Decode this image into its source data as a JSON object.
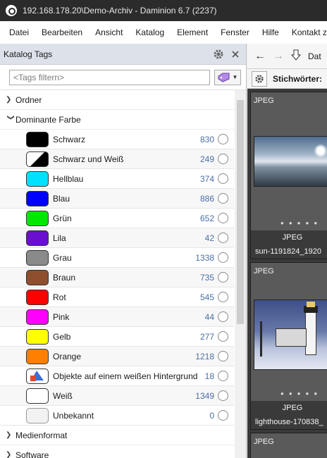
{
  "window": {
    "title": "192.168.178.20\\Demo-Archiv - Daminion 6.7 (2237)"
  },
  "menu": [
    "Datei",
    "Bearbeiten",
    "Ansicht",
    "Katalog",
    "Element",
    "Fenster",
    "Hilfe",
    "Kontakt z"
  ],
  "panel": {
    "title": "Katalog Tags",
    "filter_placeholder": "<Tags filtern>"
  },
  "groups": {
    "ordner": "Ordner",
    "dominante": "Dominante Farbe",
    "medienformat": "Medienformat",
    "software": "Software"
  },
  "colors": [
    {
      "label": "Schwarz",
      "count": "830",
      "color": "#000000"
    },
    {
      "label": "Schwarz und Weiß",
      "count": "249",
      "color": "split"
    },
    {
      "label": "Hellblau",
      "count": "374",
      "color": "#00e1ff"
    },
    {
      "label": "Blau",
      "count": "886",
      "color": "#0000ff"
    },
    {
      "label": "Grün",
      "count": "652",
      "color": "#00e800"
    },
    {
      "label": "Lila",
      "count": "42",
      "color": "#6a0fd0"
    },
    {
      "label": "Grau",
      "count": "1338",
      "color": "#8a8a8a"
    },
    {
      "label": "Braun",
      "count": "735",
      "color": "#8f4e2e"
    },
    {
      "label": "Rot",
      "count": "545",
      "color": "#ff0000"
    },
    {
      "label": "Pink",
      "count": "44",
      "color": "#ff00ff"
    },
    {
      "label": "Gelb",
      "count": "277",
      "color": "#ffff00"
    },
    {
      "label": "Orange",
      "count": "1218",
      "color": "#ff8000"
    },
    {
      "label": "Objekte auf einem weißen Hintergrund",
      "count": "18",
      "color": "shapes"
    },
    {
      "label": "Weiß",
      "count": "1349",
      "color": "#ffffff"
    },
    {
      "label": "Unbekannt",
      "count": "0",
      "color": "#f2f2f2"
    }
  ],
  "nav": {
    "crumb": "Dat"
  },
  "keywords": {
    "label": "Stichwörter:"
  },
  "items": [
    {
      "type": "JPEG",
      "meta_type": "JPEG",
      "filename": "sun-1191824_1920"
    },
    {
      "type": "JPEG",
      "meta_type": "JPEG",
      "filename": "lighthouse-170838_"
    },
    {
      "type": "JPEG"
    }
  ],
  "accent": {
    "count_color": "#4a6fa5",
    "header_bg": "#dde2ea",
    "titlebar_bg": "#2b2b2b"
  }
}
